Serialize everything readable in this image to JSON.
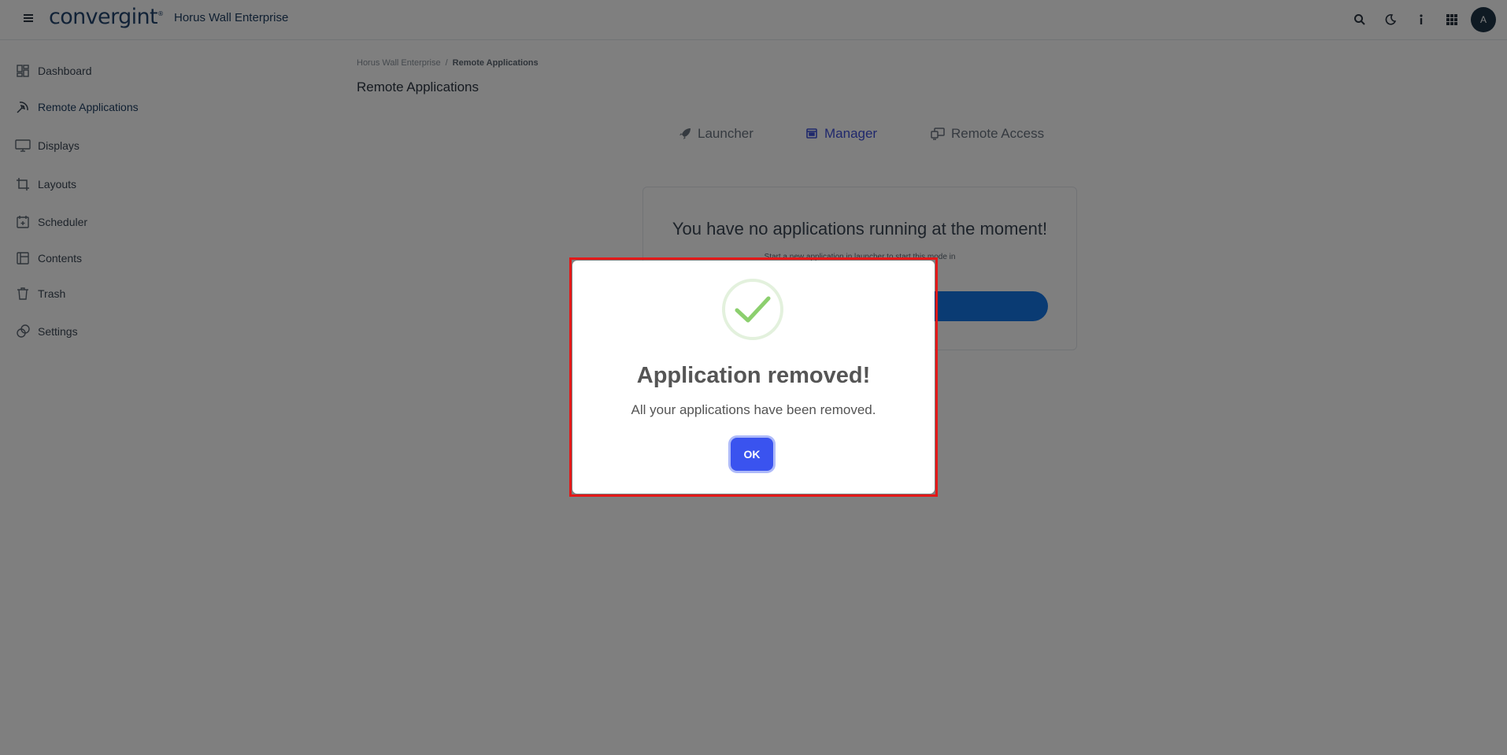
{
  "topbar": {
    "logo_text": "convergint",
    "app_name": "Horus Wall Enterprise",
    "icons": [
      "search-icon",
      "moon-icon",
      "info-icon",
      "apps-grid-icon"
    ],
    "avatar_initial": "A"
  },
  "sidebar": {
    "items": [
      {
        "label": "Dashboard",
        "icon": "dashboard-icon"
      },
      {
        "label": "Remote Applications",
        "icon": "remote-apps-icon"
      },
      {
        "label": "Displays",
        "icon": "monitor-icon"
      },
      {
        "label": "Layouts",
        "icon": "crop-icon"
      },
      {
        "label": "Scheduler",
        "icon": "calendar-icon"
      },
      {
        "label": "Contents",
        "icon": "contents-icon"
      },
      {
        "label": "Trash",
        "icon": "trash-icon"
      },
      {
        "label": "Settings",
        "icon": "settings-icon"
      }
    ],
    "active_index": 1
  },
  "breadcrumb": {
    "root": "Horus Wall Enterprise",
    "separator": "/",
    "current": "Remote Applications"
  },
  "page_title": "Remote Applications",
  "tabs": [
    {
      "label": "Launcher",
      "icon": "rocket-icon"
    },
    {
      "label": "Manager",
      "icon": "window-icon",
      "active": true
    },
    {
      "label": "Remote Access",
      "icon": "remote-access-icon"
    }
  ],
  "empty_state": {
    "title": "You have no applications running at the moment!",
    "subtitle": "Start a new application in launcher to start this mode in",
    "button_label": ""
  },
  "dialog": {
    "icon": "success-check-icon",
    "title": "Application removed!",
    "message": "All your applications have been removed.",
    "ok_label": "OK"
  },
  "colors": {
    "accent": "#3a53ef",
    "brand": "#23456e",
    "primary_button": "#1477e6",
    "success": "#8ccf6e",
    "highlight_outline": "#e31818"
  }
}
